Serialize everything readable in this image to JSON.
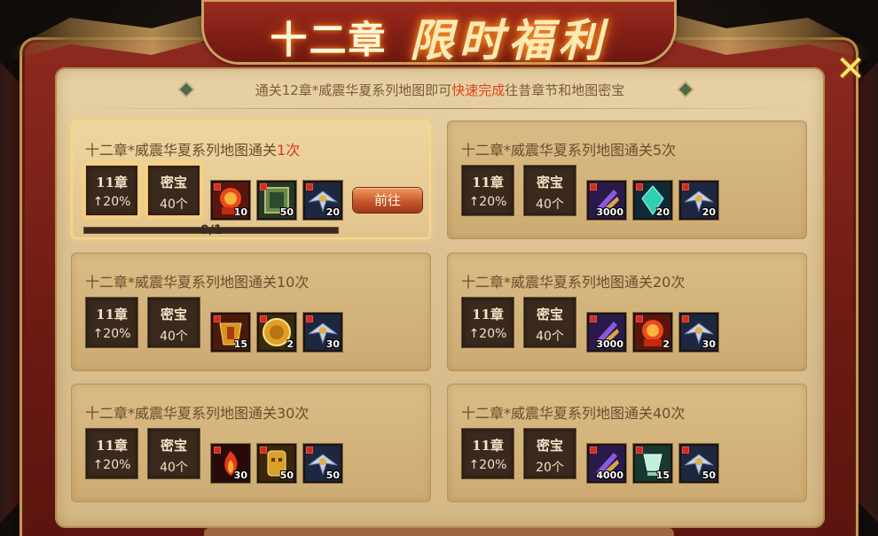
{
  "header": {
    "title_chapter": "十二章",
    "title_main": "限时福利",
    "close_glyph": "✕"
  },
  "subtitle": {
    "prefix": "通关12章*威震华夏系列地图即可",
    "highlight": "快速完成",
    "suffix": "往昔章节和地图密宝"
  },
  "cards": [
    {
      "title": "十二章*威震华夏系列地图通关",
      "count": "1次",
      "count_highlight": true,
      "tag1": {
        "line1": "11章",
        "line2": "↑20%"
      },
      "tag2": {
        "line1": "密宝",
        "line2": "40个"
      },
      "items": [
        {
          "name": "red-beast-icon",
          "qty": "10"
        },
        {
          "name": "green-book-icon",
          "qty": "50"
        },
        {
          "name": "blue-wings-icon",
          "qty": "20"
        }
      ],
      "button": "前往",
      "progress": "0/1",
      "progress_value": 0
    },
    {
      "title": "十二章*威震华夏系列地图通关5次",
      "count": "",
      "tag1": {
        "line1": "11章",
        "line2": "↑20%"
      },
      "tag2": {
        "line1": "密宝",
        "line2": "40个"
      },
      "items": [
        {
          "name": "purple-scroll-icon",
          "qty": "3000"
        },
        {
          "name": "teal-crystal-icon",
          "qty": "20"
        },
        {
          "name": "blue-wings-icon",
          "qty": "20"
        }
      ]
    },
    {
      "title": "十二章*威震华夏系列地图通关10次",
      "count": "",
      "tag1": {
        "line1": "11章",
        "line2": "↑20%"
      },
      "tag2": {
        "line1": "密宝",
        "line2": "40个"
      },
      "items": [
        {
          "name": "gold-armor-icon",
          "qty": "15"
        },
        {
          "name": "gold-coin-icon",
          "qty": "2"
        },
        {
          "name": "blue-wings-icon",
          "qty": "30"
        }
      ]
    },
    {
      "title": "十二章*威震华夏系列地图通关20次",
      "count": "",
      "tag1": {
        "line1": "11章",
        "line2": "↑20%"
      },
      "tag2": {
        "line1": "密宝",
        "line2": "40个"
      },
      "items": [
        {
          "name": "purple-scroll-icon",
          "qty": "3000"
        },
        {
          "name": "red-beast-icon",
          "qty": "2"
        },
        {
          "name": "blue-wings-icon",
          "qty": "30"
        }
      ]
    },
    {
      "title": "十二章*威震华夏系列地图通关30次",
      "count": "",
      "tag1": {
        "line1": "11章",
        "line2": "↑20%"
      },
      "tag2": {
        "line1": "密宝",
        "line2": "40个"
      },
      "items": [
        {
          "name": "red-flame-icon",
          "qty": "30"
        },
        {
          "name": "gold-mask-icon",
          "qty": "50"
        },
        {
          "name": "blue-wings-icon",
          "qty": "50"
        }
      ]
    },
    {
      "title": "十二章*威震华夏系列地图通关40次",
      "count": "",
      "tag1": {
        "line1": "11章",
        "line2": "↑20%"
      },
      "tag2": {
        "line1": "密宝",
        "line2": "20个"
      },
      "items": [
        {
          "name": "purple-scroll-icon",
          "qty": "4000"
        },
        {
          "name": "green-cup-icon",
          "qty": "15"
        },
        {
          "name": "blue-wings-icon",
          "qty": "50"
        }
      ]
    }
  ],
  "colors": {
    "frame_red": "#8e2a1f",
    "panel_parchment": "#dcc293",
    "highlight_red": "#d43a1a",
    "text_brown": "#6a4d2d"
  }
}
